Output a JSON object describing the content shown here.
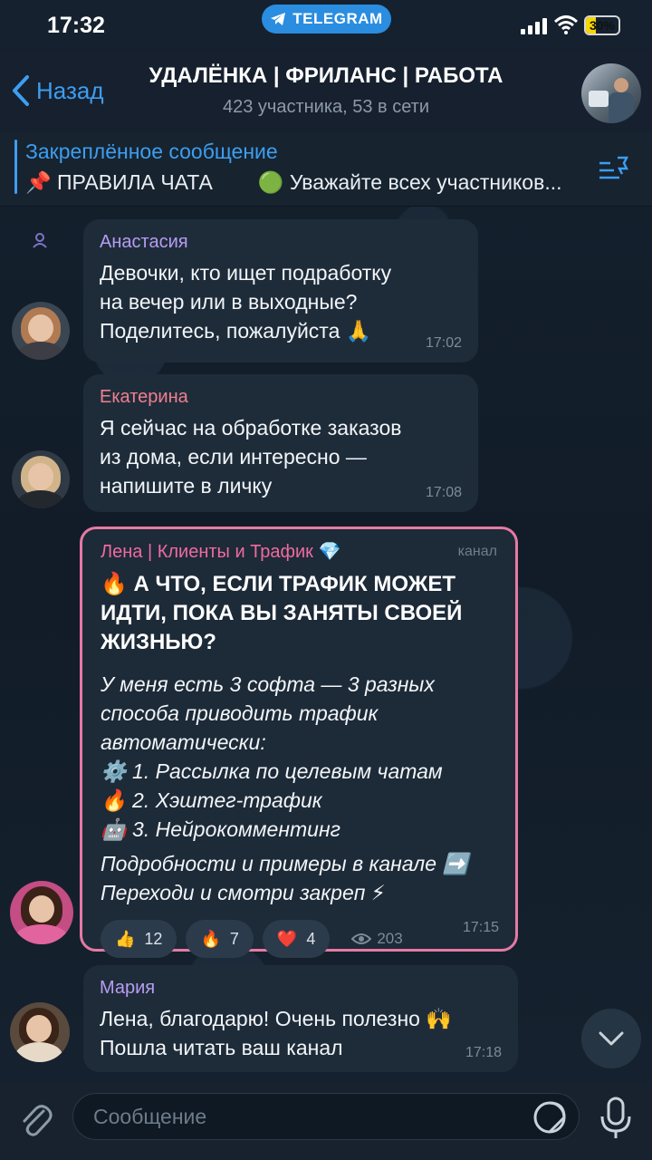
{
  "status_bar": {
    "time": "17:32",
    "telegram_label": "TELEGRAM",
    "battery_level": "30%",
    "battery_fraction": 0.3
  },
  "header": {
    "back_label": "Назад",
    "title": "УДАЛЁНКА | ФРИЛАНС | РАБОТА",
    "subtitle": "423 участника, 53 в сети"
  },
  "pinned": {
    "label": "Закреплённое сообщение",
    "text_a": "📌 ПРАВИЛА ЧАТА",
    "text_b": "🟢 Уважайте всех участников..."
  },
  "messages": [
    {
      "sender": "Анастасия",
      "sender_color": "#b79cf2",
      "lines": [
        "Девочки, кто ищет подработку",
        "на вечер или в выходные?",
        "Поделитесь, пожалуйста 🙏"
      ],
      "time": "17:02"
    },
    {
      "sender": "Екатерина",
      "sender_color": "#f07f8e",
      "lines": [
        "Я сейчас на обработке заказов",
        "из дома, если интересно —",
        "напишите в личку"
      ],
      "time": "17:08"
    },
    {
      "sender": "Мария",
      "sender_color": "#b79cf2",
      "lines": [
        "Лена, благодарю! Очень полезно 🙌",
        "Пошла читать ваш канал"
      ],
      "time": "17:18"
    }
  ],
  "channel_post": {
    "sender": "Лена | Клиенты и Трафик 💎",
    "sender_color": "#f06aa0",
    "tag": "канал",
    "headline": [
      "🔥 А ЧТО, ЕСЛИ ТРАФИК МОЖЕТ",
      "ИДТИ, ПОКА ВЫ ЗАНЯТЫ СВОЕЙ",
      "ЖИЗНЬЮ?"
    ],
    "body": [
      "У меня есть 3 софта — 3 разных",
      "способа приводить трафик",
      "автоматически:",
      "⚙️ 1. Рассылка по целевым чатам",
      "🔥 2. Хэштег-трафик",
      "🤖 3. Нейрокомментинг"
    ],
    "footer": [
      "Подробности и примеры в канале ➡️",
      "Переходи и смотри закреп ⚡"
    ],
    "reactions": [
      {
        "emoji": "👍",
        "count": "12"
      },
      {
        "emoji": "🔥",
        "count": "7"
      },
      {
        "emoji": "❤️",
        "count": "4"
      }
    ],
    "views": "203",
    "time": "17:15"
  },
  "input": {
    "placeholder": "Сообщение"
  }
}
